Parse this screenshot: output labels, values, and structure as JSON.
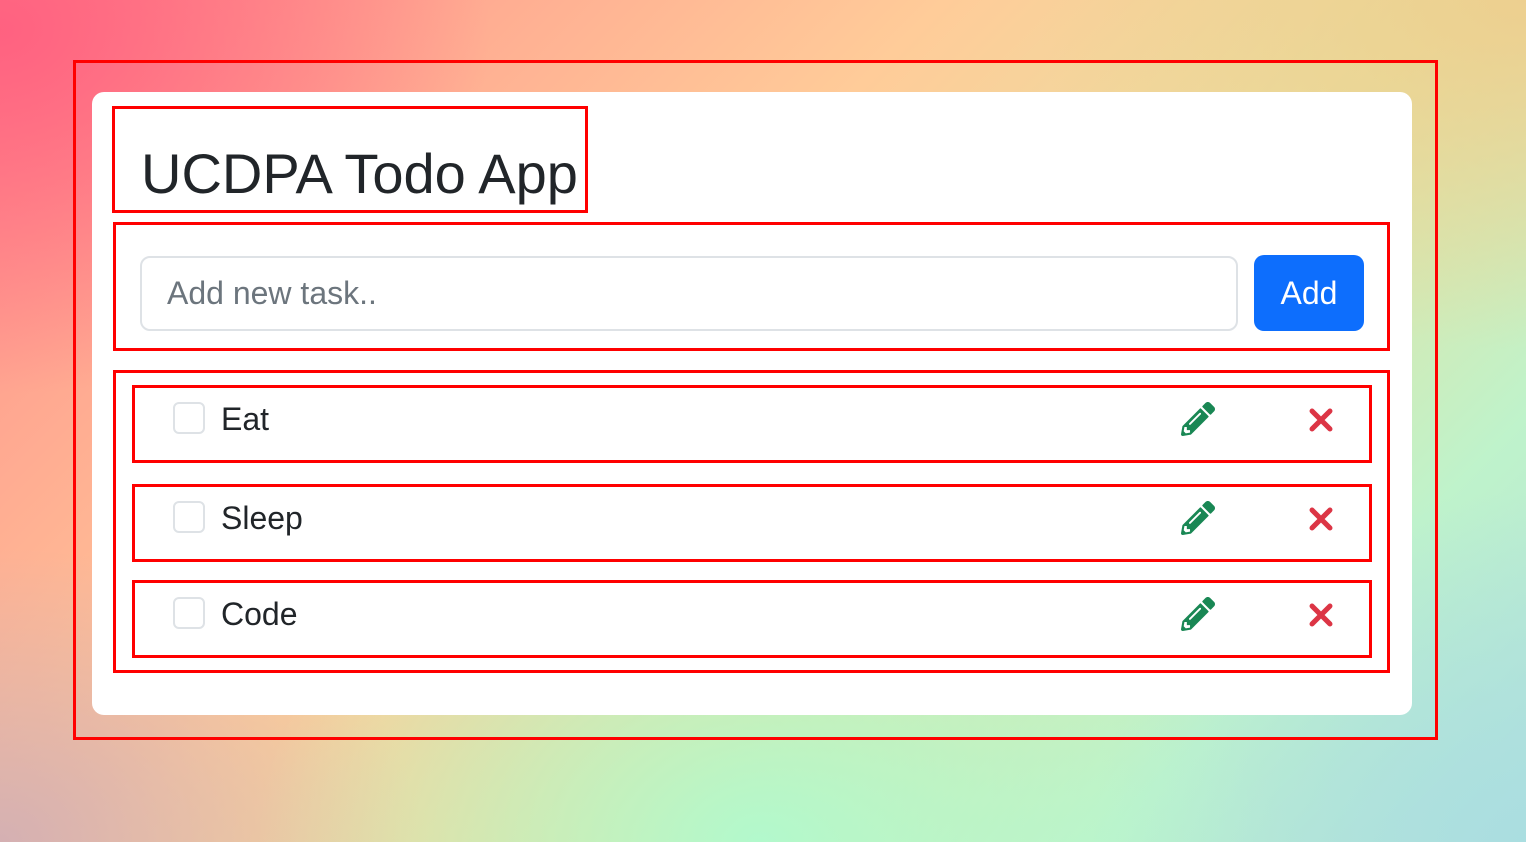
{
  "app": {
    "title": "UCDPA Todo App"
  },
  "form": {
    "input_placeholder": "Add new task..",
    "input_value": "",
    "add_label": "Add"
  },
  "todos": [
    {
      "label": "Eat",
      "checked": false,
      "edit_icon": "pencil-icon",
      "delete_icon": "close-icon"
    },
    {
      "label": "Sleep",
      "checked": false,
      "edit_icon": "pencil-icon",
      "delete_icon": "close-icon"
    },
    {
      "label": "Code",
      "checked": false,
      "edit_icon": "pencil-icon",
      "delete_icon": "close-icon"
    }
  ],
  "colors": {
    "primary": "#0d6efd",
    "edit": "#198754",
    "delete": "#dc3545",
    "annotation": "#ff0000",
    "text": "#212529"
  }
}
